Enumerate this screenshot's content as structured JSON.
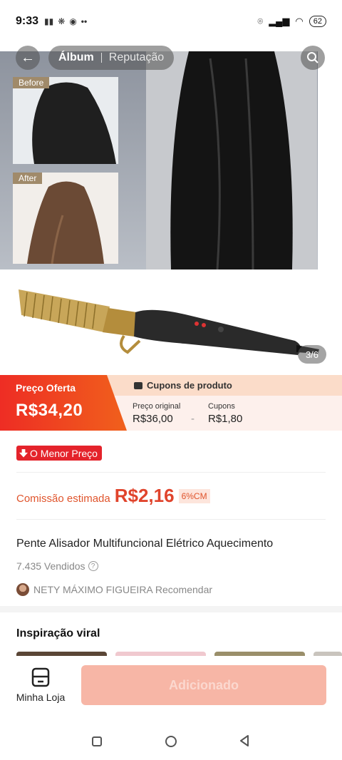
{
  "status_bar": {
    "time": "9:33",
    "battery": "62"
  },
  "gallery": {
    "tabs": [
      {
        "label": "Álbum"
      },
      {
        "label": "Reputação"
      }
    ],
    "before_tag": "Before",
    "after_tag": "After",
    "counter": "3/6"
  },
  "price": {
    "offer_label": "Preço Oferta",
    "offer_value": "R$34,20",
    "coupons_header": "Cupons de produto",
    "original_label": "Preço original",
    "original_value": "R$36,00",
    "minus": "-",
    "coupons_label": "Cupons",
    "coupons_value": "R$1,80"
  },
  "info": {
    "lowest_badge": "O Menor Preço",
    "commission_label": "Comissão estimada",
    "commission_value": "R$2,16",
    "commission_pct": "6%CM",
    "product_title": "Pente Alisador Multifuncional Elétrico Aquecimento",
    "sold": "7.435 Vendidos",
    "recommender": "NETY MÁXIMO FIGUEIRA Recomendar",
    "viral_title": "Inspiração viral"
  },
  "bottom": {
    "store_label": "Minha Loja",
    "add_button": "Adicionado"
  },
  "colors": {
    "accent": "#ee2d24",
    "commission": "#e0442c",
    "button_disabled": "#f7b6a6"
  }
}
